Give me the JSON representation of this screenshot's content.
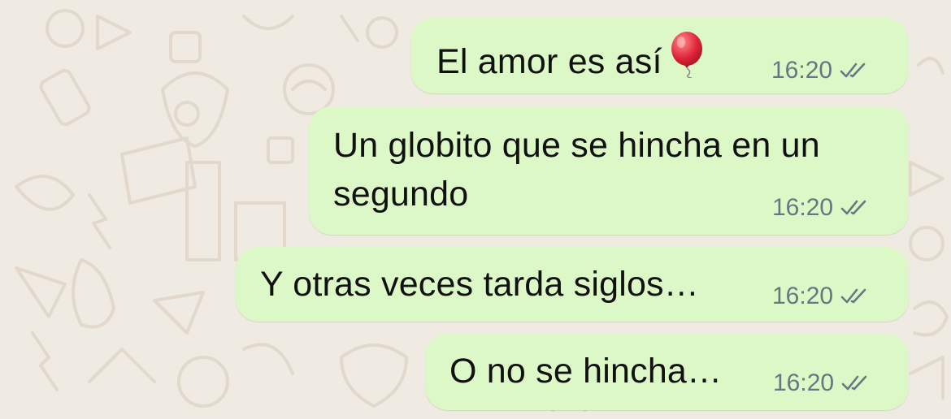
{
  "chat": {
    "messages": [
      {
        "text": "El amor es así",
        "time": "16:20",
        "status_icon": "double-check-icon",
        "emoji": "balloon-icon"
      },
      {
        "text_line1": "Un globito que se hincha en un",
        "text_line2": "segundo",
        "time": "16:20",
        "status_icon": "double-check-icon"
      },
      {
        "text": "Y otras veces tarda siglos…",
        "time": "16:20",
        "status_icon": "double-check-icon"
      },
      {
        "text": "O no se hincha…",
        "time": "16:20",
        "status_icon": "double-check-icon"
      }
    ]
  },
  "colors": {
    "background": "#efeae2",
    "bubble_outgoing": "#dcf8c6",
    "timestamp": "#667781",
    "text": "#111111"
  }
}
